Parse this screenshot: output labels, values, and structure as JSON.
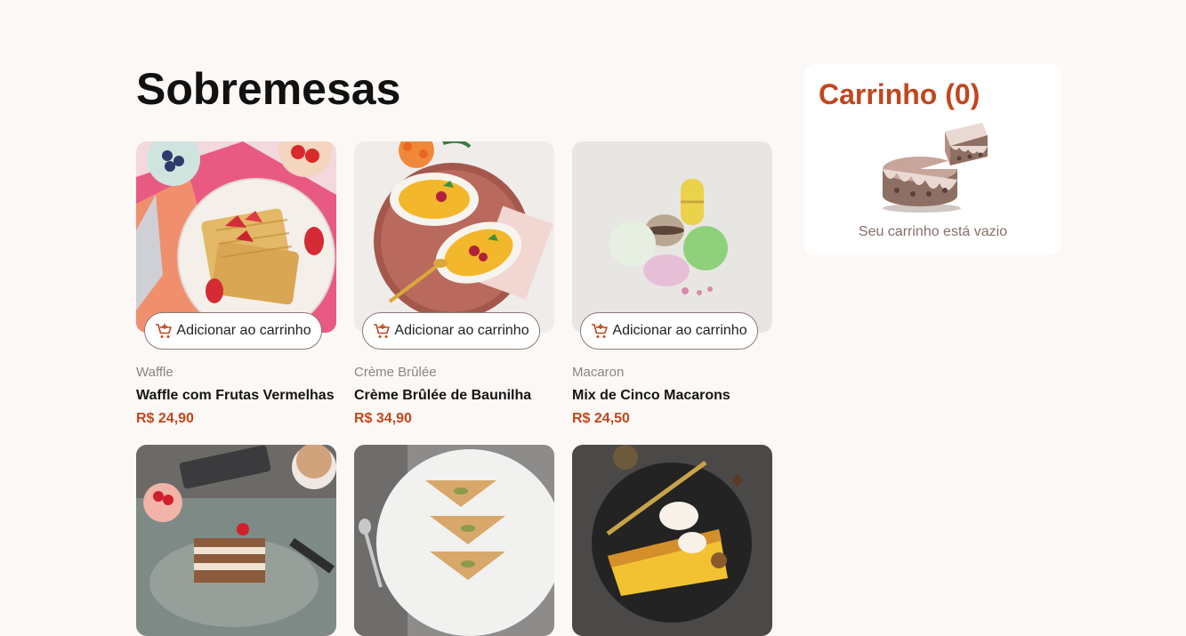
{
  "page": {
    "title": "Sobremesas"
  },
  "add_button_label": "Adicionar ao carrinho",
  "products": [
    {
      "category": "Waffle",
      "name": "Waffle com Frutas Vermelhas",
      "price": "R$ 24,90"
    },
    {
      "category": "Crème Brûlée",
      "name": "Crème Brûlée de Baunilha",
      "price": "R$ 34,90"
    },
    {
      "category": "Macaron",
      "name": "Mix de Cinco Macarons",
      "price": "R$ 24,50"
    },
    {
      "category": "",
      "name": "",
      "price": ""
    },
    {
      "category": "",
      "name": "",
      "price": ""
    },
    {
      "category": "",
      "name": "",
      "price": ""
    }
  ],
  "cart": {
    "title": "Carrinho (0)",
    "empty_text": "Seu carrinho está vazio"
  },
  "colors": {
    "background": "#fcf8f5",
    "accent": "#c0471f",
    "muted_text": "#8a8583"
  },
  "icons": {
    "add_to_cart": "cart-plus-icon",
    "empty_cart": "empty-cake-illustration"
  }
}
